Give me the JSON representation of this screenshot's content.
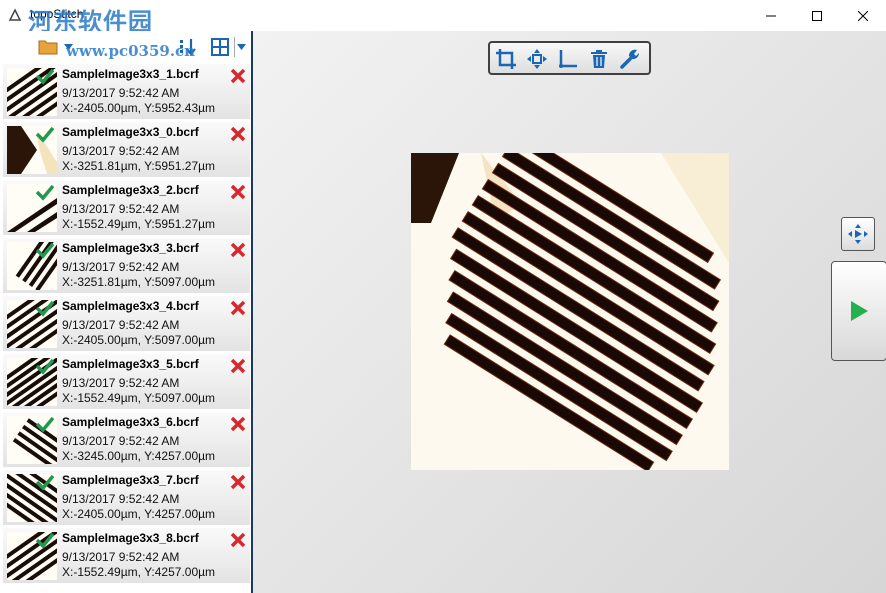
{
  "window": {
    "title": "topoStitch",
    "watermark": "河东软件园",
    "watermark_url": "www.pc0359.cn",
    "minimize_icon": "minimize-icon",
    "maximize_icon": "maximize-icon",
    "close_icon": "close-icon"
  },
  "left_toolbar": {
    "icons": [
      "folder-open-icon",
      "dropdown-arrow-icon",
      "sort-down-icon",
      "grid-layout-icon",
      "dropdown-arrow-icon"
    ]
  },
  "images": [
    {
      "name": "SampleImage3x3_1.bcrf",
      "date": "9/13/2017 9:52:42 AM",
      "coords": "X:-2405.00µm, Y:5952.43µm"
    },
    {
      "name": "SampleImage3x3_0.bcrf",
      "date": "9/13/2017 9:52:42 AM",
      "coords": "X:-3251.81µm, Y:5951.27µm"
    },
    {
      "name": "SampleImage3x3_2.bcrf",
      "date": "9/13/2017 9:52:42 AM",
      "coords": "X:-1552.49µm, Y:5951.27µm"
    },
    {
      "name": "SampleImage3x3_3.bcrf",
      "date": "9/13/2017 9:52:42 AM",
      "coords": "X:-3251.81µm, Y:5097.00µm"
    },
    {
      "name": "SampleImage3x3_4.bcrf",
      "date": "9/13/2017 9:52:42 AM",
      "coords": "X:-2405.00µm, Y:5097.00µm"
    },
    {
      "name": "SampleImage3x3_5.bcrf",
      "date": "9/13/2017 9:52:42 AM",
      "coords": "X:-1552.49µm, Y:5097.00µm"
    },
    {
      "name": "SampleImage3x3_6.bcrf",
      "date": "9/13/2017 9:52:42 AM",
      "coords": "X:-3245.00µm, Y:4257.00µm"
    },
    {
      "name": "SampleImage3x3_7.bcrf",
      "date": "9/13/2017 9:52:42 AM",
      "coords": "X:-2405.00µm, Y:4257.00µm"
    },
    {
      "name": "SampleImage3x3_8.bcrf",
      "date": "9/13/2017 9:52:42 AM",
      "coords": "X:-1552.49µm, Y:4257.00µm"
    }
  ],
  "canvas_toolbar": {
    "tools": [
      "crop-icon",
      "move-icon",
      "axes-icon",
      "trash-icon",
      "wrench-icon"
    ]
  },
  "side_buttons": {
    "small": "expand-arrows-icon",
    "large": "play-icon"
  },
  "colors": {
    "accent": "#1a66b3",
    "check": "#1e9a4a",
    "delete": "#d9272e",
    "play": "#22b14c"
  }
}
